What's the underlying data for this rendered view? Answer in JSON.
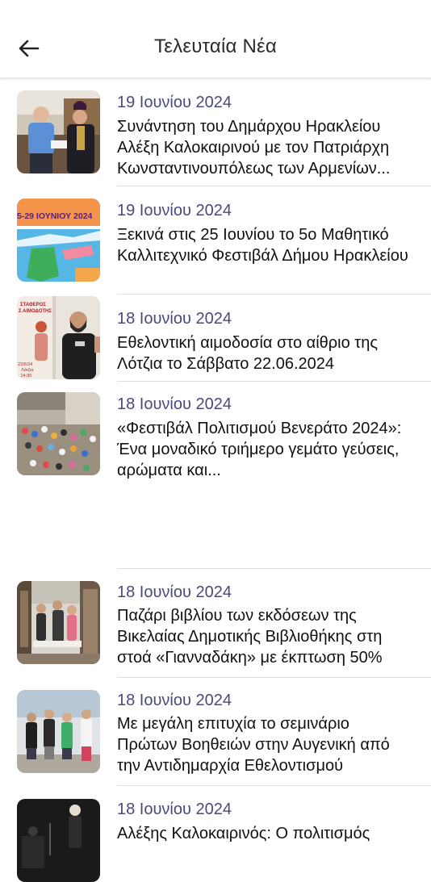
{
  "header": {
    "title": "Τελευταία Νέα",
    "back_icon": "arrow-left-icon"
  },
  "news": [
    {
      "date": "19 Ιουνίου 2024",
      "title": "Συνάντηση του Δημάρχου Ηρακλείου Αλέξη Καλοκαιρινού με τον Πατριάρχη Κωνσταντινουπόλεως των Αρμενίων..."
    },
    {
      "date": "19 Ιουνίου 2024",
      "title": "Ξεκινά στις 25 Ιουνίου το 5ο Μαθητικό Καλλιτεχνικό Φεστιβάλ Δήμου Ηρακλείου",
      "thumb_text": "5-29 ΙΟΥΝΙΟΥ 2024"
    },
    {
      "date": "18 Ιουνίου 2024",
      "title": "Εθελοντική αιμοδοσία στο αίθριο της Λότζια το Σάββατο 22.06.2024",
      "thumb_text_1": "ΣΤΑΘΕΡΟΣ",
      "thumb_text_2": "Σ ΑΙΜΟΔΟΤΗΣ",
      "thumb_text_3": "22/6/24",
      "thumb_text_4": "Λότζια",
      "thumb_text_5": "- 14:30"
    },
    {
      "date": "18 Ιουνίου 2024",
      "title": "«Φεστιβάλ Πολιτισμού Βενεράτο 2024»: Ένα μοναδικό τριήμερο γεμάτο γεύσεις, αρώματα και..."
    },
    {
      "date": "18 Ιουνίου 2024",
      "title": "Παζάρι βιβλίου των εκδόσεων της Βικελαίας Δημοτικής Βιβλιοθήκης στη στοά «Γιανναδάκη» με έκπτωση 50%"
    },
    {
      "date": "18 Ιουνίου 2024",
      "title": "Με μεγάλη επιτυχία το σεμινάριο Πρώτων Βοηθειών στην Αυγενική από την Αντιδημαρχία Εθελοντισμού"
    },
    {
      "date": "18 Ιουνίου 2024",
      "title": "Αλέξης Καλοκαιρινός: Ο πολιτισμός"
    }
  ]
}
